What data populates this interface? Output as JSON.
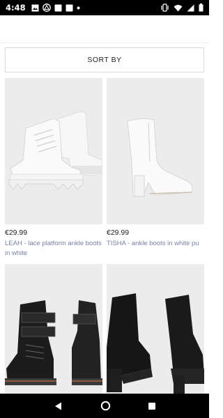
{
  "status_bar": {
    "time": "4:48",
    "left_icons": [
      "image-icon",
      "alert-triangle-icon",
      "white-square-icon",
      "white-square-icon",
      "dot-icon"
    ],
    "right_icons": [
      "vibrate-icon",
      "wifi-icon",
      "signal-icon",
      "battery-icon"
    ]
  },
  "sort": {
    "label": "SORT BY"
  },
  "products": [
    {
      "price": "€29.99",
      "title": "LEAH - lace platform ankle boots in white",
      "image_desc": "white-lace-up-platform-boots"
    },
    {
      "price": "€29.99",
      "title": "TISHA - ankle boots in white pu",
      "image_desc": "white-heeled-ankle-boot"
    },
    {
      "price": "",
      "title": "",
      "image_desc": "black-buckle-combat-boots"
    },
    {
      "price": "",
      "title": "",
      "image_desc": "black-platform-heeled-ankle-boots"
    }
  ],
  "colors": {
    "status_bg": "#000000",
    "title_link": "#7a7fa6",
    "image_bg": "#ebebeb"
  }
}
